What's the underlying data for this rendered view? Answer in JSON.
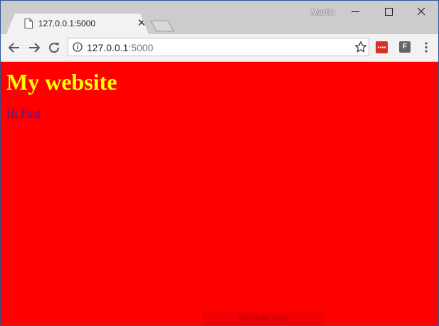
{
  "window": {
    "profile_name": "Martin",
    "controls": {
      "minimize": "minimize-icon",
      "maximize": "maximize-icon",
      "close": "close-icon"
    }
  },
  "tabs": [
    {
      "title": "127.0.0.1:5000",
      "icon": "page-icon",
      "active": true
    }
  ],
  "toolbar": {
    "url_host": "127.0.0.1",
    "url_port": ":5000",
    "ext2_label": "F"
  },
  "page": {
    "heading": "My website",
    "link_text": "Hi Paul",
    "background_color": "#ff0000",
    "heading_color": "#ffff00",
    "link_color": "#551a8b"
  },
  "overlay": {
    "snip_label": "Window Snip"
  }
}
